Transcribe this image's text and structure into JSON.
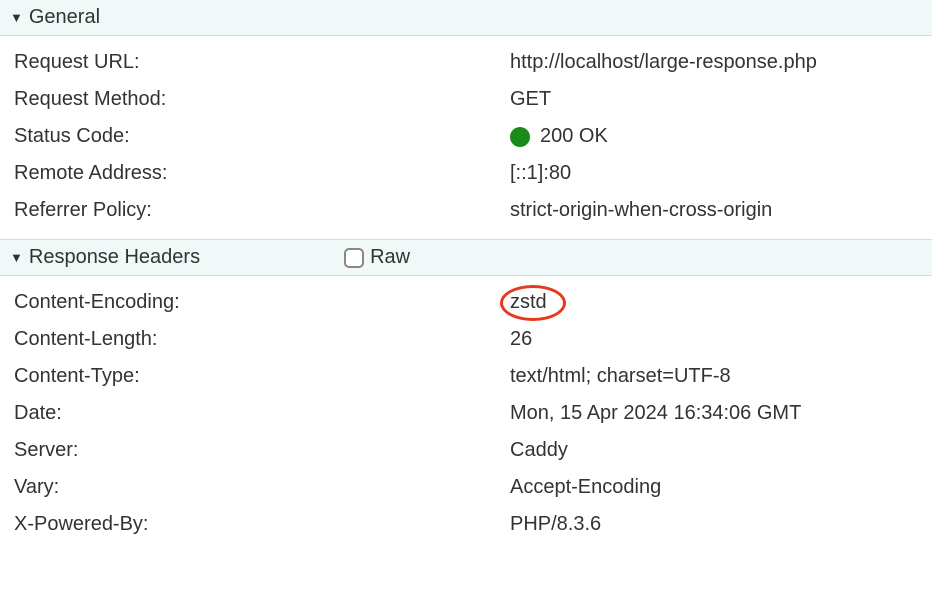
{
  "sections": {
    "general": {
      "title": "General",
      "rows": [
        {
          "label": "Request URL:",
          "value": "http://localhost/large-response.php"
        },
        {
          "label": "Request Method:",
          "value": "GET"
        },
        {
          "label": "Status Code:",
          "value": "200 OK",
          "status": true
        },
        {
          "label": "Remote Address:",
          "value": "[::1]:80"
        },
        {
          "label": "Referrer Policy:",
          "value": "strict-origin-when-cross-origin"
        }
      ]
    },
    "responseHeaders": {
      "title": "Response Headers",
      "rawLabel": "Raw",
      "rows": [
        {
          "label": "Content-Encoding:",
          "value": "zstd",
          "highlighted": true
        },
        {
          "label": "Content-Length:",
          "value": "26"
        },
        {
          "label": "Content-Type:",
          "value": "text/html; charset=UTF-8"
        },
        {
          "label": "Date:",
          "value": "Mon, 15 Apr 2024 16:34:06 GMT"
        },
        {
          "label": "Server:",
          "value": "Caddy"
        },
        {
          "label": "Vary:",
          "value": "Accept-Encoding"
        },
        {
          "label": "X-Powered-By:",
          "value": "PHP/8.3.6"
        }
      ]
    }
  }
}
